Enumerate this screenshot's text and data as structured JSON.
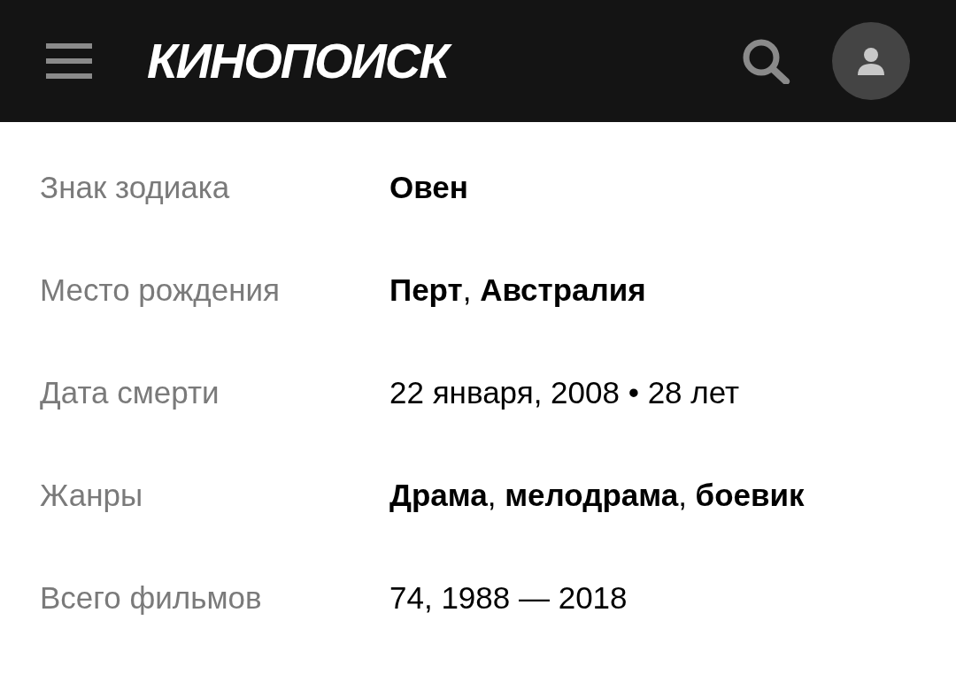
{
  "header": {
    "logo": "КИНОПОИСК"
  },
  "facts": [
    {
      "label": "Знак зодиака",
      "value": "Овен",
      "kind": "link"
    },
    {
      "label": "Место рождения",
      "value": "**Перт**, **Австралия**",
      "kind": "mixed"
    },
    {
      "label": "Дата смерти",
      "value": "22 января, 2008 • 28 лет",
      "kind": "text"
    },
    {
      "label": "Жанры",
      "value": "**Драма**, **мелодрама**, **боевик**",
      "kind": "mixed"
    },
    {
      "label": "Всего фильмов",
      "value": "74, 1988 — 2018",
      "kind": "text"
    }
  ]
}
